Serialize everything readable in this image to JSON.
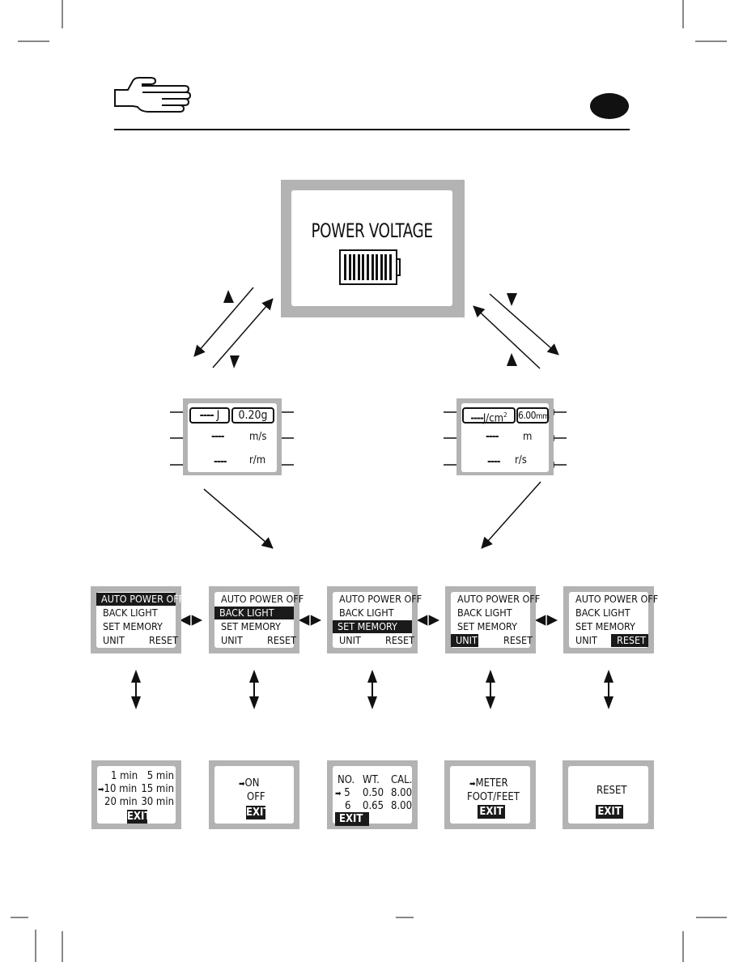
{
  "header": {
    "hand_icon": "pointing-hand-icon",
    "badge_icon": "language-badge-ellipse"
  },
  "power_screen": {
    "title": "POWER VOLTAGE",
    "battery_icon": "battery-full-icon",
    "battery_bars": 11
  },
  "left_readout": {
    "energy_value": "----",
    "energy_unit": "J",
    "weight": "0.20g",
    "speed_value": "----",
    "speed_unit": "m/s",
    "rate_value": "----",
    "rate_unit": "r/m"
  },
  "right_readout": {
    "energy_value": "----",
    "energy_unit": "J/cm",
    "energy_unit_sup": "2",
    "caliber": "6.00",
    "caliber_unit": "mm",
    "distance_value": "----",
    "distance_unit": "m",
    "rate_value": "----",
    "rate_unit": "r/s"
  },
  "menu": {
    "items": [
      "AUTO POWER OFF",
      "BACK LIGHT",
      "SET  MEMORY",
      "UNIT",
      "RESET"
    ],
    "screens": [
      {
        "selected": "AUTO POWER OFF"
      },
      {
        "selected": "BACK LIGHT"
      },
      {
        "selected": "SET  MEMORY"
      },
      {
        "selected": "UNIT"
      },
      {
        "selected": "RESET"
      }
    ]
  },
  "submenus": {
    "auto_power_off": {
      "options": [
        [
          "1 min",
          "5 min"
        ],
        [
          "10 min",
          "15 min"
        ],
        [
          "20 min",
          "30 min"
        ]
      ],
      "selected": "10 min",
      "exit": "EXIT"
    },
    "back_light": {
      "options": [
        "ON",
        "OFF"
      ],
      "selected": "ON",
      "exit": "EXIT"
    },
    "set_memory": {
      "headers": [
        "NO.",
        "WT.",
        "CAL."
      ],
      "rows": [
        [
          "5",
          "0.50",
          "8.00"
        ],
        [
          "6",
          "0.65",
          "8.00"
        ]
      ],
      "selected_row": "5",
      "exit": "EXIT"
    },
    "unit": {
      "options": [
        "METER",
        "FOOT/FEET"
      ],
      "selected": "METER",
      "exit": "EXIT"
    },
    "reset": {
      "label": "RESET",
      "exit": "EXIT"
    }
  },
  "symbols": {
    "pointer_arrow": "➡"
  }
}
